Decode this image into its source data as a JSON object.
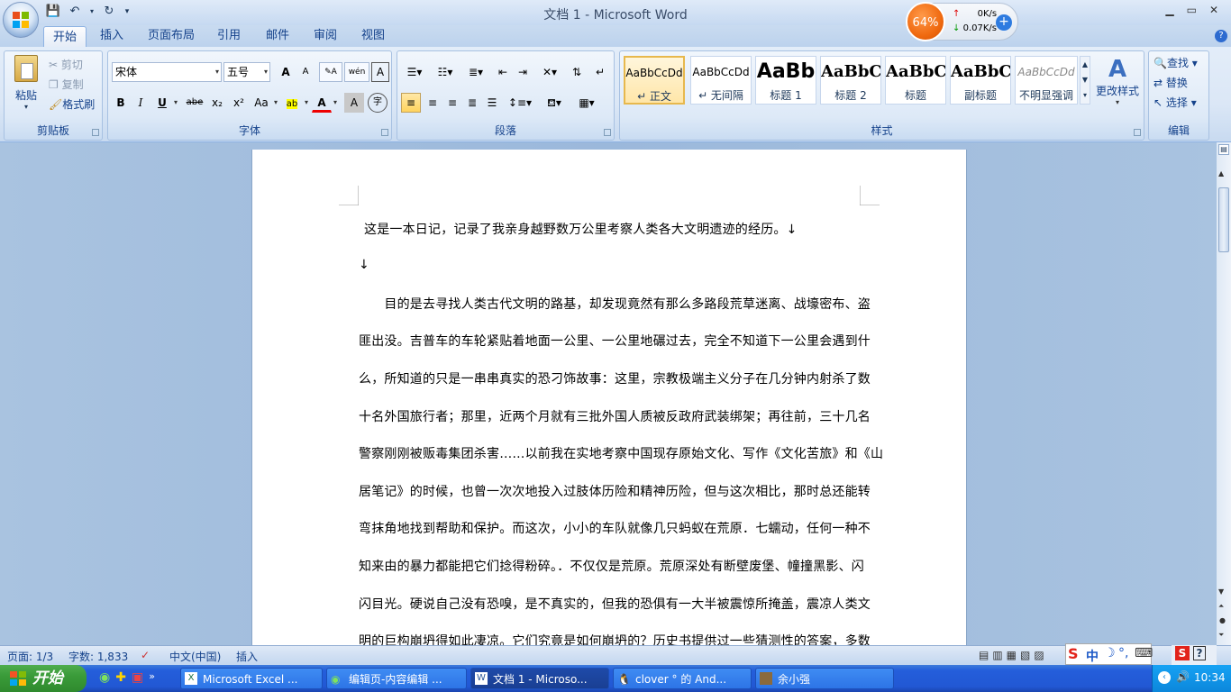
{
  "window": {
    "title": "文档 1 - Microsoft Word"
  },
  "net_widget": {
    "percent": "64%",
    "up": "0K/s",
    "down": "0.07K/s"
  },
  "tabs": [
    "开始",
    "插入",
    "页面布局",
    "引用",
    "邮件",
    "审阅",
    "视图"
  ],
  "clipboard": {
    "paste": "粘贴",
    "cut": "剪切",
    "copy": "复制",
    "format_painter": "格式刷",
    "label": "剪贴板"
  },
  "font": {
    "name": "宋体",
    "size": "五号",
    "label": "字体",
    "bold": "B",
    "italic": "I",
    "underline": "U",
    "strike": "abe",
    "sub": "x₂",
    "sup": "x²",
    "case": "Aa",
    "grow": "A",
    "shrink": "A",
    "wen": "wén",
    "border_a": "A",
    "color_a": "A",
    "shade_a": "A",
    "enclose": "字"
  },
  "paragraph": {
    "label": "段落"
  },
  "styles": {
    "label": "样式",
    "items": [
      {
        "sample": "AaBbCcDd",
        "name": "↵ 正文"
      },
      {
        "sample": "AaBbCcDd",
        "name": "↵ 无间隔"
      },
      {
        "sample": "AaBb",
        "name": "标题 1"
      },
      {
        "sample": "AaBbC",
        "name": "标题 2"
      },
      {
        "sample": "AaBbC",
        "name": "标题"
      },
      {
        "sample": "AaBbC",
        "name": "副标题"
      },
      {
        "sample": "AaBbCcDd",
        "name": "不明显强调"
      }
    ],
    "change": "更改样式"
  },
  "editing": {
    "find": "查找",
    "replace": "替换",
    "select": "选择",
    "label": "编辑"
  },
  "document": {
    "lines": [
      "这是一本日记，记录了我亲身越野数万公里考察人类各大文明遗迹的经历。↓",
      "↓",
      "　　目的是去寻找人类古代文明的路基，却发现竟然有那么多路段荒草迷离、战壕密布、盗",
      "匪出没。吉普车的车轮紧贴着地面一公里、一公里地碾过去，完全不知道下一公里会遇到什",
      "么，所知道的只是一串串真实的恐刁饰故事：这里，宗教极端主义分子在几分钟内射杀了数",
      "十名外国旅行者；那里，近两个月就有三批外国人质被反政府武装绑架；再往前，三十几名",
      "警察刚刚被贩毒集团杀害……以前我在实地考察中国现存原始文化、写作《文化苦旅》和《山",
      "居笔记》的时候，也曾一次次地投入过肢体历险和精神历险，但与这次相比，那时总还能转",
      "弯抹角地找到帮助和保护。而这次，小小的车队就像几只蚂蚁在荒原．七蠕动，任何一种不",
      "知来由的暴力都能把它们捻得粉碎。．不仅仅是荒原。荒原深处有断壁废堡、幢撞黑影、闪",
      "闪目光。硬说自己没有恐嗅，是不真实的，但我的恐俱有一大半被震惊所掩盖，震凉人类文",
      "明的巨构崩坍得如此凄凉。它们究竟是如何崩坍的？历史书提供过一些猜测性的答案，多数"
    ]
  },
  "status": {
    "page": "页面: 1/3",
    "words": "字数: 1,833",
    "lang": "中文(中国)",
    "mode": "插入"
  },
  "taskbar": {
    "start": "开始",
    "items": [
      "Microsoft Excel ...",
      "编辑页-内容编辑 ...",
      "文档 1 - Microso...",
      "clover ° 的 And...",
      "余小强"
    ],
    "time": "10:34"
  },
  "ime": {
    "mode": "中"
  }
}
